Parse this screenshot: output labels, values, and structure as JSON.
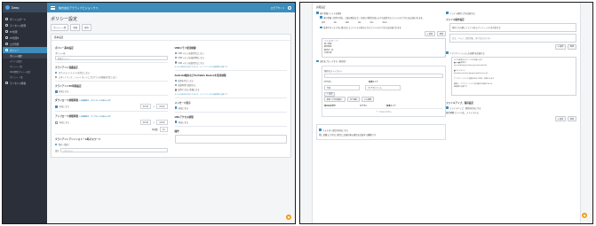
{
  "colors": {
    "primary": "#3c8dbc",
    "sidebar": "#2b2f3a",
    "accent": "#f39c12"
  },
  "left": {
    "brand": "Deep",
    "topbar_title": "株式会社アクティブビジョンクス",
    "topbar_user": "ログアウト ▾",
    "sidebar": {
      "items": [
        {
          "label": "ダッシュボード",
          "icon": "home-icon"
        },
        {
          "label": "ライセンス管理",
          "icon": "license-icon"
        },
        {
          "label": "PC管理",
          "icon": "pc-icon"
        },
        {
          "label": "PC管理2",
          "icon": "pc-icon"
        },
        {
          "label": "ログ管理",
          "icon": "log-icon"
        },
        {
          "label": "ポリシー",
          "icon": "policy-icon"
        }
      ],
      "subitems": [
        "ポリシー設定",
        "デバイス設定",
        "ポリシー一覧",
        "Web閲覧ポリシー設定",
        "ポリシー 一覧",
        "ライセンス情報"
      ]
    },
    "page_title": "ポリシー設定",
    "buttons": [
      "ポリシー一覧",
      "新規",
      "保存"
    ],
    "panel_head": "基本設定",
    "col1": {
      "basic_title": "ポリシー基本設定",
      "policy_name_label": "ポリシー名",
      "policy_name_value": "新規ポリシー",
      "client_title": "クライアント保護設定",
      "client_opt1": "ダウンロードファイルを禁止しない",
      "client_opt2": "スタートアップ、ショートカットにプログラムの登録を禁止しない",
      "monitor_title": "クライアントPC時間設定",
      "monitor_check": "有効にする",
      "download_title": "ダウンロード制限時間",
      "download_note": "この時間帯は、ダウンロードを禁止します",
      "download_check": "有効にする",
      "time_from": "09:00",
      "time_to": "18:00",
      "upload_title": "アップロード制限時間",
      "upload_note": "この時間帯は、アップロードを禁止します",
      "upload_check": "有効にする",
      "time_from2": "09:00",
      "time_to2": "18:00",
      "duration_label": "時間数",
      "duration_value": "10",
      "install_title": "クライアントアンインストール時パスワード",
      "install_radio": "無効（既定）",
      "pw_label": "設定",
      "pw_placeholder": "パスワード"
    },
    "col2": {
      "usb_title": "USBメモリ使用制御",
      "usb_opt1": "USB メモリを使用禁止しない",
      "usb_opt2": "USB メモリを読取専用にする",
      "usb_opt3": "USB メモリを使用禁止にする",
      "usb_note": "※ 以上の設定を有効にするには、クライアントPCの再起動が必要です。",
      "android_title": "Android端末などPortable Deviceを使用制限",
      "android_opt1": "使用を禁止しない",
      "android_opt2": "読取専用で使用する",
      "android_opt3": "使用できない状態にする",
      "android_note": "※ 以上の設定を有効にするには、クライアントPCの再起動が必要です。",
      "message_title": "メッセージ表示",
      "message_check": "有効にする",
      "url_title": "URLアクセス制限",
      "url_check": "有効にする",
      "other_title": "操作"
    }
  },
  "right": {
    "header": "詳細設定",
    "left": {
      "ext_check": "個人情報ファイルを保存",
      "ext_desc": "個人情報（住所や氏名、口座の暗証など）を含む可能性が高い以下の拡張子のファイルのアクセスは記録されます。",
      "exts": [
        "pdf",
        "xls",
        "xlsx",
        "csv",
        "doc",
        "docx"
      ],
      "other_check": "拡張子のリスト内に書き出したファイル以外の以下のファイルのアクセスは記録されます",
      "add_btn": "+ 追加",
      "del_btn": "削除",
      "list": [
        "ファイルサーバー",
        "個人情報",
        "顧客情報",
        "顧客名一覧",
        "社員名簿"
      ],
      "upload_check": "送信をブロックする（無効化）",
      "dir_label": "保存先ディレクトリ",
      "category_label": "カテゴリ",
      "type_label": "保護タイプ",
      "category_value": "作成",
      "type_value": "すべてのファイル",
      "add_btn2": "+ 追加",
      "mini_btns": [
        "削除（下位の項目）",
        "全て選択",
        "上に移動"
      ],
      "tbl_cols": [
        "保存先文字列",
        "カテゴリ",
        "保護タイプ"
      ],
      "tbl_empty": "データはありません",
      "bottom_check": "フォルダー設定を有効にする",
      "bottom_desc": "他に見積もりがない場合に記録対象の通信を記録する機能です"
    },
    "right": {
      "check1": "ファイル操作ログを記録する",
      "file_title": "ファイル操作設定",
      "box_value": "保存される際にファイル名のプレフィックスを付加する",
      "box2_value": "ロゴ、バッジ、日付けを、すべてのファイル",
      "add_btn": "+ 追加",
      "del_btn": "削除",
      "check2": "アプリケーションによる操作を記録する",
      "list_lines": [
        "以下の拡張子のファイルを記録します",
        "■exe■(拡張子)",
        "exe,cmd,bat,ps1,vbs,js,jse,wsh,wsf,hta",
        "",
        "■ドキュメント",
        "doc,docx,xls,xlsx,ppt,pptx,pdf,txt,csv,rtf",
        "",
        "アプリケーションに変更を加えた際は、記録されます",
        "",
        "最後に、アプリケーション内の操作を記録するには",
        "再起動が必要です"
      ],
      "panel2_head": "ファイルアップ、保持設定",
      "panel2_check": "ファイルアップ、保持を有効にする",
      "panel2_label": "保持期間ファイル名、ファイルパス",
      "add2": "+ 追加",
      "del2": "削除"
    }
  }
}
